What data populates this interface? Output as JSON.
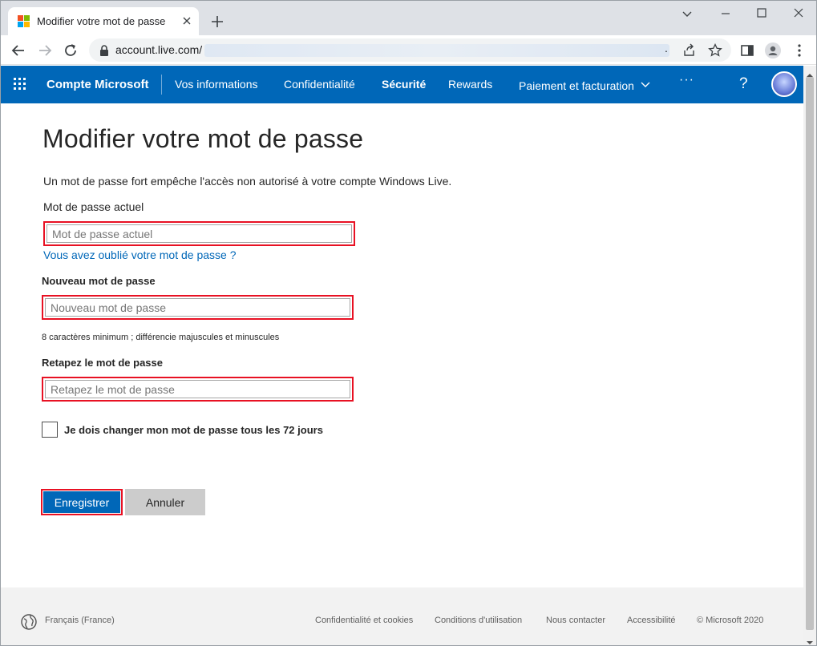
{
  "browser": {
    "tab_title": "Modifier votre mot de passe",
    "url": "account.live.com/",
    "url_trail": "."
  },
  "header": {
    "brand": "Compte Microsoft",
    "nav": [
      {
        "label": "Vos informations"
      },
      {
        "label": "Confidentialité"
      },
      {
        "label": "Sécurité",
        "active": true
      },
      {
        "label": "Rewards"
      },
      {
        "label": "Paiement et facturation"
      }
    ],
    "more": "···",
    "help": "?"
  },
  "form": {
    "title": "Modifier votre mot de passe",
    "intro": "Un mot de passe fort empêche l'accès non autorisé à votre compte Windows Live.",
    "current_label": "Mot de passe actuel",
    "current_placeholder": "Mot de passe actuel",
    "forgot_link": "Vous avez oublié votre mot de passe ?",
    "new_label": "Nouveau mot de passe",
    "new_placeholder": "Nouveau mot de passe",
    "new_hint": "8 caractères minimum ; différencie majuscules et minuscules",
    "retype_label": "Retapez le mot de passe",
    "retype_placeholder": "Retapez le mot de passe",
    "checkbox_label": "Je dois changer mon mot de passe tous les 72 jours",
    "checkbox_checked": false,
    "save_label": "Enregistrer",
    "cancel_label": "Annuler"
  },
  "footer": {
    "language": "Français (France)",
    "links": [
      "Confidentialité et cookies",
      "Conditions d'utilisation",
      "Nous contacter",
      "Accessibilité",
      "© Microsoft 2020"
    ]
  },
  "colors": {
    "accent": "#0067b8",
    "highlight": "#e81123"
  }
}
